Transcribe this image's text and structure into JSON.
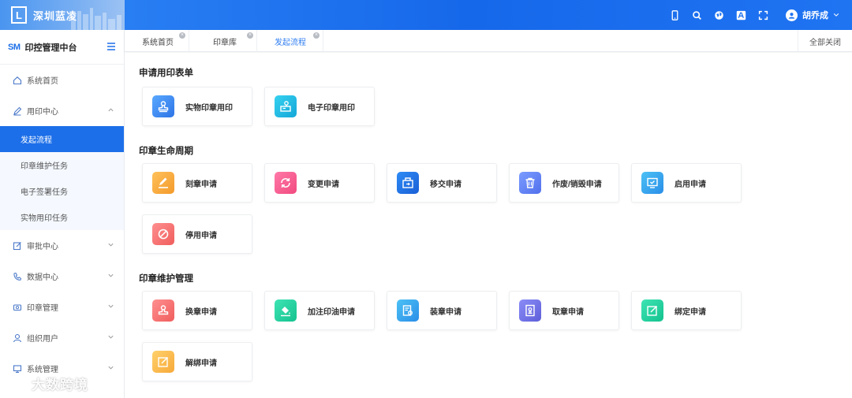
{
  "brand": {
    "logo_letter": "L",
    "name": "深圳蓝凌"
  },
  "topbar": {
    "icons": [
      "mobile-icon",
      "search-icon",
      "globe-icon",
      "translate-icon",
      "fullscreen-icon"
    ],
    "user_name": "胡乔成"
  },
  "sidebar": {
    "logo_text": "SM",
    "title": "印控管理中台",
    "items": [
      {
        "label": "系统首页",
        "icon": "home-icon"
      },
      {
        "label": "用印中心",
        "icon": "pen-icon",
        "expanded": true
      },
      {
        "label": "审批中心",
        "icon": "edit-icon"
      },
      {
        "label": "数据中心",
        "icon": "phone-icon"
      },
      {
        "label": "印章管理",
        "icon": "seal-icon"
      },
      {
        "label": "组织用户",
        "icon": "user-icon"
      },
      {
        "label": "系统管理",
        "icon": "monitor-icon"
      }
    ],
    "sub_items": [
      {
        "label": "发起流程",
        "active": true
      },
      {
        "label": "印章维护任务"
      },
      {
        "label": "电子签署任务"
      },
      {
        "label": "实物用印任务"
      }
    ]
  },
  "tabs": [
    {
      "label": "系统首页"
    },
    {
      "label": "印章库"
    },
    {
      "label": "发起流程",
      "active": true
    }
  ],
  "close_all_label": "全部关闭",
  "sections": [
    {
      "title": "申请用印表单",
      "cards": [
        {
          "label": "实物印章用印",
          "icon": "stamp-icon",
          "color": "#2d74e6"
        },
        {
          "label": "电子印章用印",
          "icon": "e-stamp-icon",
          "color": "#14a6d8"
        }
      ]
    },
    {
      "title": "印章生命周期",
      "cards": [
        {
          "label": "刻章申请",
          "icon": "engrave-icon",
          "color": "#f39a2b"
        },
        {
          "label": "变更申请",
          "icon": "refresh-icon",
          "color": "#f14a7f"
        },
        {
          "label": "移交申请",
          "icon": "transfer-icon",
          "color": "#1a5fd6"
        },
        {
          "label": "作废/销毁申请",
          "icon": "trash-icon",
          "color": "#5170ec"
        },
        {
          "label": "启用申请",
          "icon": "enable-icon",
          "color": "#2a8ee8"
        },
        {
          "label": "停用申请",
          "icon": "stop-icon",
          "color": "#f05d5d"
        }
      ]
    },
    {
      "title": "印章维护管理",
      "cards": [
        {
          "label": "换章申请",
          "icon": "swap-stamp-icon",
          "color": "#f05d5d"
        },
        {
          "label": "加注印油申请",
          "icon": "ink-icon",
          "color": "#14c28e"
        },
        {
          "label": "装章申请",
          "icon": "install-icon",
          "color": "#2a8ee8"
        },
        {
          "label": "取章申请",
          "icon": "retrieve-icon",
          "color": "#5e5fd9"
        },
        {
          "label": "绑定申请",
          "icon": "bind-icon",
          "color": "#14c28e"
        },
        {
          "label": "解绑申请",
          "icon": "unbind-icon",
          "color": "#f7a93a"
        }
      ]
    }
  ],
  "watermark": "大数跨境"
}
